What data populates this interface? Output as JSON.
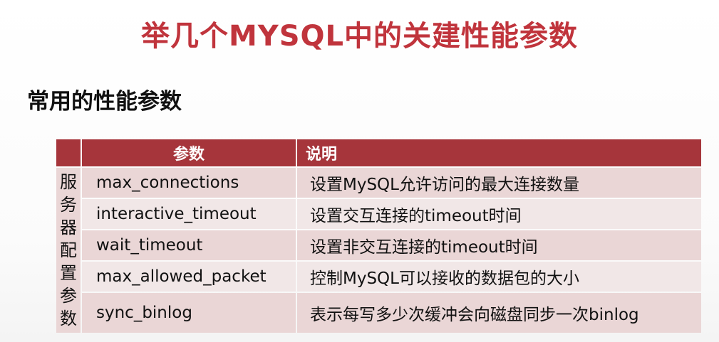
{
  "slide": {
    "title": "举几个MYSQL中的关建性能参数",
    "section_heading": "常用的性能参数"
  },
  "table": {
    "headers": {
      "group": "",
      "parameter": "参数",
      "description": "说明"
    },
    "group_label": "服务器配置参数",
    "rows": [
      {
        "parameter": "max_connections",
        "description": "设置MySQL允许访问的最大连接数量"
      },
      {
        "parameter": "interactive_timeout",
        "description": "设置交互连接的timeout时间"
      },
      {
        "parameter": "wait_timeout",
        "description": "设置非交互连接的timeout时间"
      },
      {
        "parameter": "max_allowed_packet",
        "description": "控制MySQL可以接收的数据包的大小"
      },
      {
        "parameter": "sync_binlog",
        "description": "表示每写多少次缓冲会向磁盘同步一次binlog"
      }
    ]
  },
  "colors": {
    "title": "#c0343c",
    "header_bg": "#a6353b",
    "row_bg": "#ead6d6",
    "row_alt_bg": "#f1e7e7"
  }
}
